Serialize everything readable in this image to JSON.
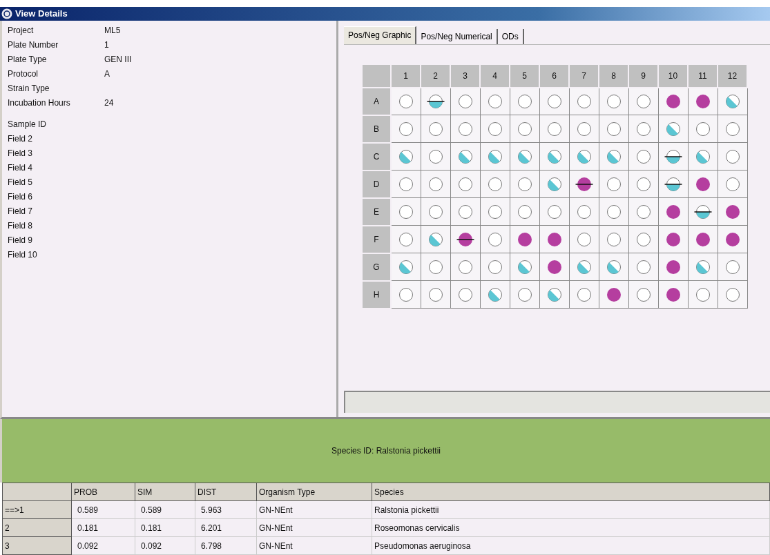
{
  "window": {
    "title": "View Details"
  },
  "details": [
    {
      "label": "Project",
      "value": "ML5"
    },
    {
      "label": "Plate Number",
      "value": "1"
    },
    {
      "label": "Plate Type",
      "value": "GEN III"
    },
    {
      "label": "Protocol",
      "value": "A"
    },
    {
      "label": "Strain Type"
    },
    {
      "label": "Incubation Hours",
      "value": "24"
    }
  ],
  "fields": [
    {
      "label": "Sample ID"
    },
    {
      "label": "Field 2"
    },
    {
      "label": "Field 3"
    },
    {
      "label": "Field 4"
    },
    {
      "label": "Field 5"
    },
    {
      "label": "Field 6"
    },
    {
      "label": "Field 7"
    },
    {
      "label": "Field 8"
    },
    {
      "label": "Field 9"
    },
    {
      "label": "Field 10"
    }
  ],
  "tabs": [
    {
      "label": "Pos/Neg Graphic",
      "selected": true
    },
    {
      "label": "Pos/Neg Numerical",
      "selected": false
    },
    {
      "label": "ODs",
      "selected": false
    }
  ],
  "plate": {
    "columns": [
      "1",
      "2",
      "3",
      "4",
      "5",
      "6",
      "7",
      "8",
      "9",
      "10",
      "11",
      "12"
    ],
    "rows": [
      {
        "label": "A",
        "wells": [
          {
            "kind": "neg"
          },
          {
            "kind": "border-x"
          },
          {
            "kind": "neg"
          },
          {
            "kind": "neg"
          },
          {
            "kind": "neg"
          },
          {
            "kind": "neg"
          },
          {
            "kind": "neg"
          },
          {
            "kind": "neg"
          },
          {
            "kind": "neg"
          },
          {
            "kind": "pos"
          },
          {
            "kind": "pos"
          },
          {
            "kind": "border"
          }
        ]
      },
      {
        "label": "B",
        "wells": [
          {
            "kind": "neg"
          },
          {
            "kind": "neg"
          },
          {
            "kind": "neg"
          },
          {
            "kind": "neg"
          },
          {
            "kind": "neg"
          },
          {
            "kind": "neg"
          },
          {
            "kind": "neg"
          },
          {
            "kind": "neg"
          },
          {
            "kind": "neg"
          },
          {
            "kind": "border"
          },
          {
            "kind": "neg"
          },
          {
            "kind": "neg"
          }
        ]
      },
      {
        "label": "C",
        "wells": [
          {
            "kind": "border"
          },
          {
            "kind": "neg"
          },
          {
            "kind": "border"
          },
          {
            "kind": "border"
          },
          {
            "kind": "border"
          },
          {
            "kind": "border"
          },
          {
            "kind": "border"
          },
          {
            "kind": "border"
          },
          {
            "kind": "neg"
          },
          {
            "kind": "border-x"
          },
          {
            "kind": "border"
          },
          {
            "kind": "neg"
          }
        ]
      },
      {
        "label": "D",
        "wells": [
          {
            "kind": "neg"
          },
          {
            "kind": "neg"
          },
          {
            "kind": "neg"
          },
          {
            "kind": "neg"
          },
          {
            "kind": "neg"
          },
          {
            "kind": "border"
          },
          {
            "kind": "pos-x"
          },
          {
            "kind": "neg"
          },
          {
            "kind": "neg"
          },
          {
            "kind": "border-x"
          },
          {
            "kind": "pos"
          },
          {
            "kind": "neg"
          }
        ]
      },
      {
        "label": "E",
        "wells": [
          {
            "kind": "neg"
          },
          {
            "kind": "neg"
          },
          {
            "kind": "neg"
          },
          {
            "kind": "neg"
          },
          {
            "kind": "neg"
          },
          {
            "kind": "neg"
          },
          {
            "kind": "neg"
          },
          {
            "kind": "neg"
          },
          {
            "kind": "neg"
          },
          {
            "kind": "pos"
          },
          {
            "kind": "border-x"
          },
          {
            "kind": "pos"
          }
        ]
      },
      {
        "label": "F",
        "wells": [
          {
            "kind": "neg"
          },
          {
            "kind": "border"
          },
          {
            "kind": "pos-x"
          },
          {
            "kind": "neg"
          },
          {
            "kind": "pos"
          },
          {
            "kind": "pos"
          },
          {
            "kind": "neg"
          },
          {
            "kind": "neg"
          },
          {
            "kind": "neg"
          },
          {
            "kind": "pos"
          },
          {
            "kind": "pos"
          },
          {
            "kind": "pos"
          }
        ]
      },
      {
        "label": "G",
        "wells": [
          {
            "kind": "border"
          },
          {
            "kind": "neg"
          },
          {
            "kind": "neg"
          },
          {
            "kind": "neg"
          },
          {
            "kind": "border"
          },
          {
            "kind": "pos"
          },
          {
            "kind": "border"
          },
          {
            "kind": "border"
          },
          {
            "kind": "neg"
          },
          {
            "kind": "pos"
          },
          {
            "kind": "border"
          },
          {
            "kind": "neg"
          }
        ]
      },
      {
        "label": "H",
        "wells": [
          {
            "kind": "neg"
          },
          {
            "kind": "neg"
          },
          {
            "kind": "neg"
          },
          {
            "kind": "border"
          },
          {
            "kind": "neg"
          },
          {
            "kind": "border"
          },
          {
            "kind": "neg"
          },
          {
            "kind": "pos"
          },
          {
            "kind": "neg"
          },
          {
            "kind": "pos"
          },
          {
            "kind": "neg"
          },
          {
            "kind": "neg"
          }
        ]
      }
    ]
  },
  "species_banner": "Species ID: Ralstonia pickettii",
  "results": {
    "columns": [
      "PROB",
      "SIM",
      "DIST",
      "Organism Type",
      "Species"
    ],
    "rows": [
      {
        "rank": "==>1",
        "cells": [
          "0.589",
          "0.589",
          "5.963",
          "GN-NEnt",
          "Ralstonia pickettii"
        ]
      },
      {
        "rank": "2",
        "cells": [
          "0.181",
          "0.181",
          "6.201",
          "GN-NEnt",
          "Roseomonas cervicalis"
        ]
      },
      {
        "rank": "3",
        "cells": [
          "0.092",
          "0.092",
          "6.798",
          "GN-NEnt",
          "Pseudomonas aeruginosa"
        ]
      }
    ]
  }
}
